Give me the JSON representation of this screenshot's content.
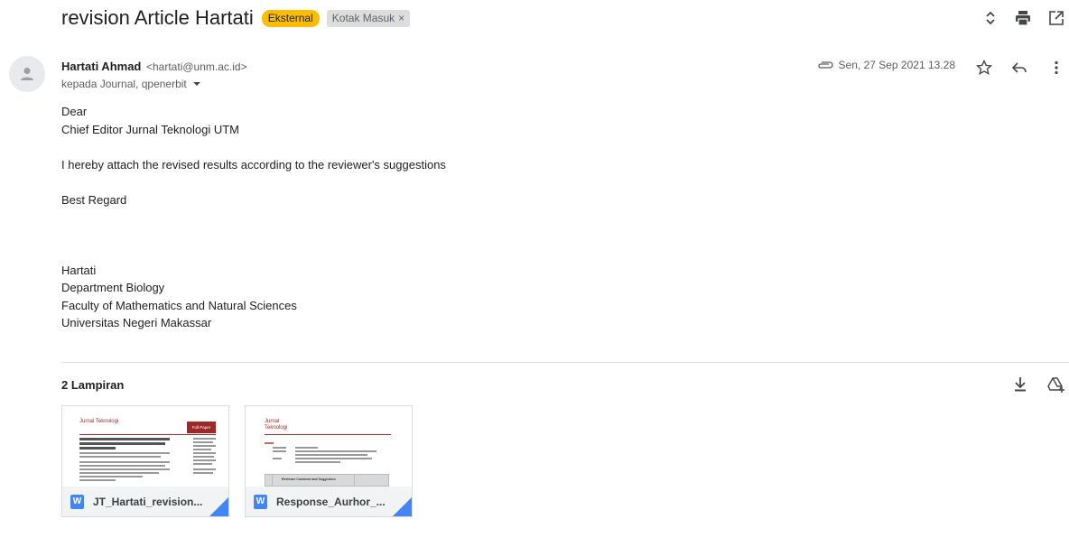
{
  "header": {
    "subject": "revision Article Hartati",
    "badge_external": "Eksternal",
    "label_inbox": "Kotak Masuk",
    "label_remove": "×"
  },
  "icons": {
    "expand": "expand-collapse-icon",
    "print": "print-icon",
    "open_new_window": "open-in-new-window-icon",
    "attachment": "paperclip-icon",
    "star": "star-icon",
    "reply": "reply-icon",
    "more": "more-vert-icon",
    "download_all": "download-icon",
    "save_drive": "add-to-drive-icon",
    "avatar": "person-icon",
    "word": "word-doc-icon"
  },
  "message": {
    "sender_name": "Hartati Ahmad",
    "sender_email": "<hartati@unm.ac.id>",
    "recipients": "kepada Journal, qpenerbit",
    "date": "Sen, 27 Sep 2021 13.28",
    "body": {
      "line1": "Dear",
      "line2": "Chief Editor Jurnal Teknologi UTM",
      "line3": "I hereby attach the revised results according to the reviewer's suggestions",
      "line4": "Best Regard",
      "sig1": "Hartati",
      "sig2": "Department Biology",
      "sig3": "Faculty of Mathematics and Natural Sciences",
      "sig4": "Universitas Negeri Makassar"
    }
  },
  "attachments": {
    "title": "2 Lampiran",
    "items": [
      {
        "name": "JT_Hartati_revision...",
        "type_glyph": "W",
        "preview_journal": "Jurnal Teknologi",
        "preview_badge": "Full Paper"
      },
      {
        "name": "Response_Aurhor_...",
        "type_glyph": "W",
        "preview_journal": "Jurnal Teknologi",
        "preview_table_header": "Reviewer Comment and Suggestion"
      }
    ]
  },
  "colors": {
    "external_badge": "#fbbc04",
    "label_chip": "#dddddd",
    "word_blue": "#4285f4",
    "journal_red": "#9c2a2a"
  }
}
